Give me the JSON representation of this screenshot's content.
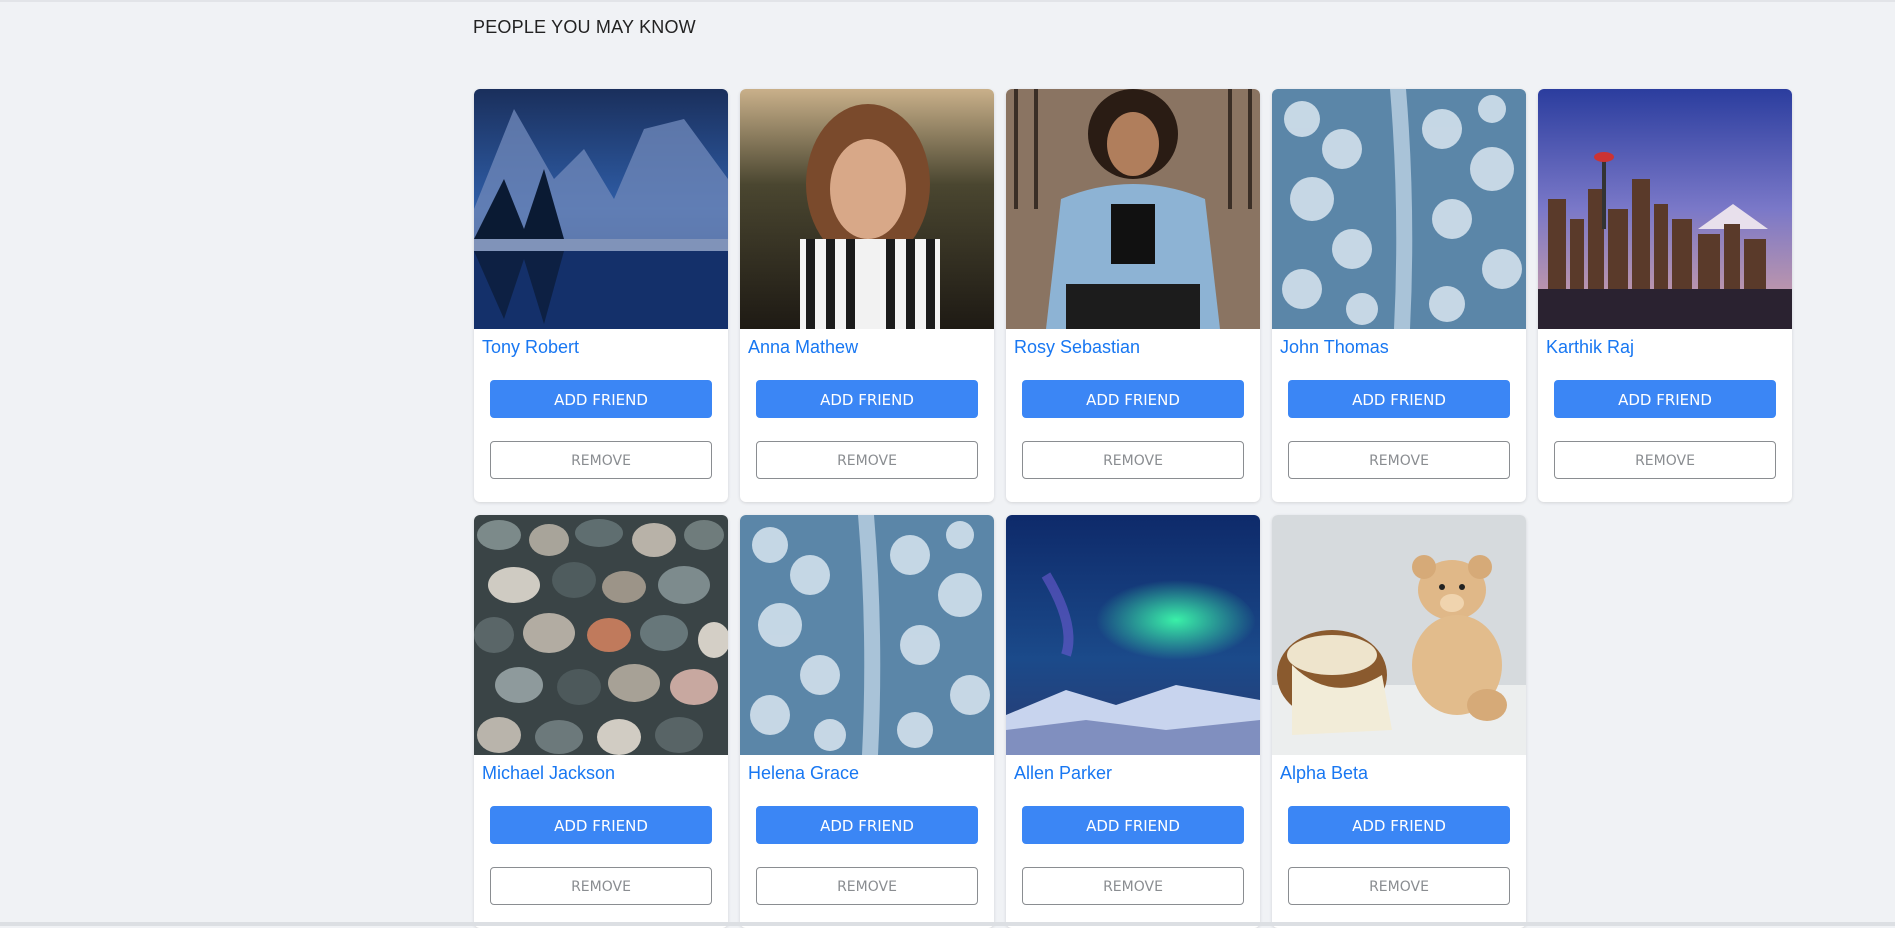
{
  "section": {
    "title": "PEOPLE YOU MAY KNOW"
  },
  "buttons": {
    "add_label": "ADD FRIEND",
    "remove_label": "REMOVE"
  },
  "people": [
    {
      "name": "Tony Robert",
      "photo": "snowy-mountain-lake-photo"
    },
    {
      "name": "Anna Mathew",
      "photo": "woman-striped-shirt-photo"
    },
    {
      "name": "Rosy Sebastian",
      "photo": "woman-denim-jacket-laptop-photo"
    },
    {
      "name": "John Thomas",
      "photo": "snowy-forest-aerial-photo"
    },
    {
      "name": "Karthik Raj",
      "photo": "city-skyline-photo"
    },
    {
      "name": "Michael Jackson",
      "photo": "pebbles-photo"
    },
    {
      "name": "Helena Grace",
      "photo": "snowy-forest-aerial-photo"
    },
    {
      "name": "Allen Parker",
      "photo": "northern-lights-photo"
    },
    {
      "name": "Alpha Beta",
      "photo": "teddy-bear-basket-photo"
    }
  ],
  "colors": {
    "link": "#1877f2",
    "primary": "#3b86f5",
    "background": "#f0f2f5"
  }
}
